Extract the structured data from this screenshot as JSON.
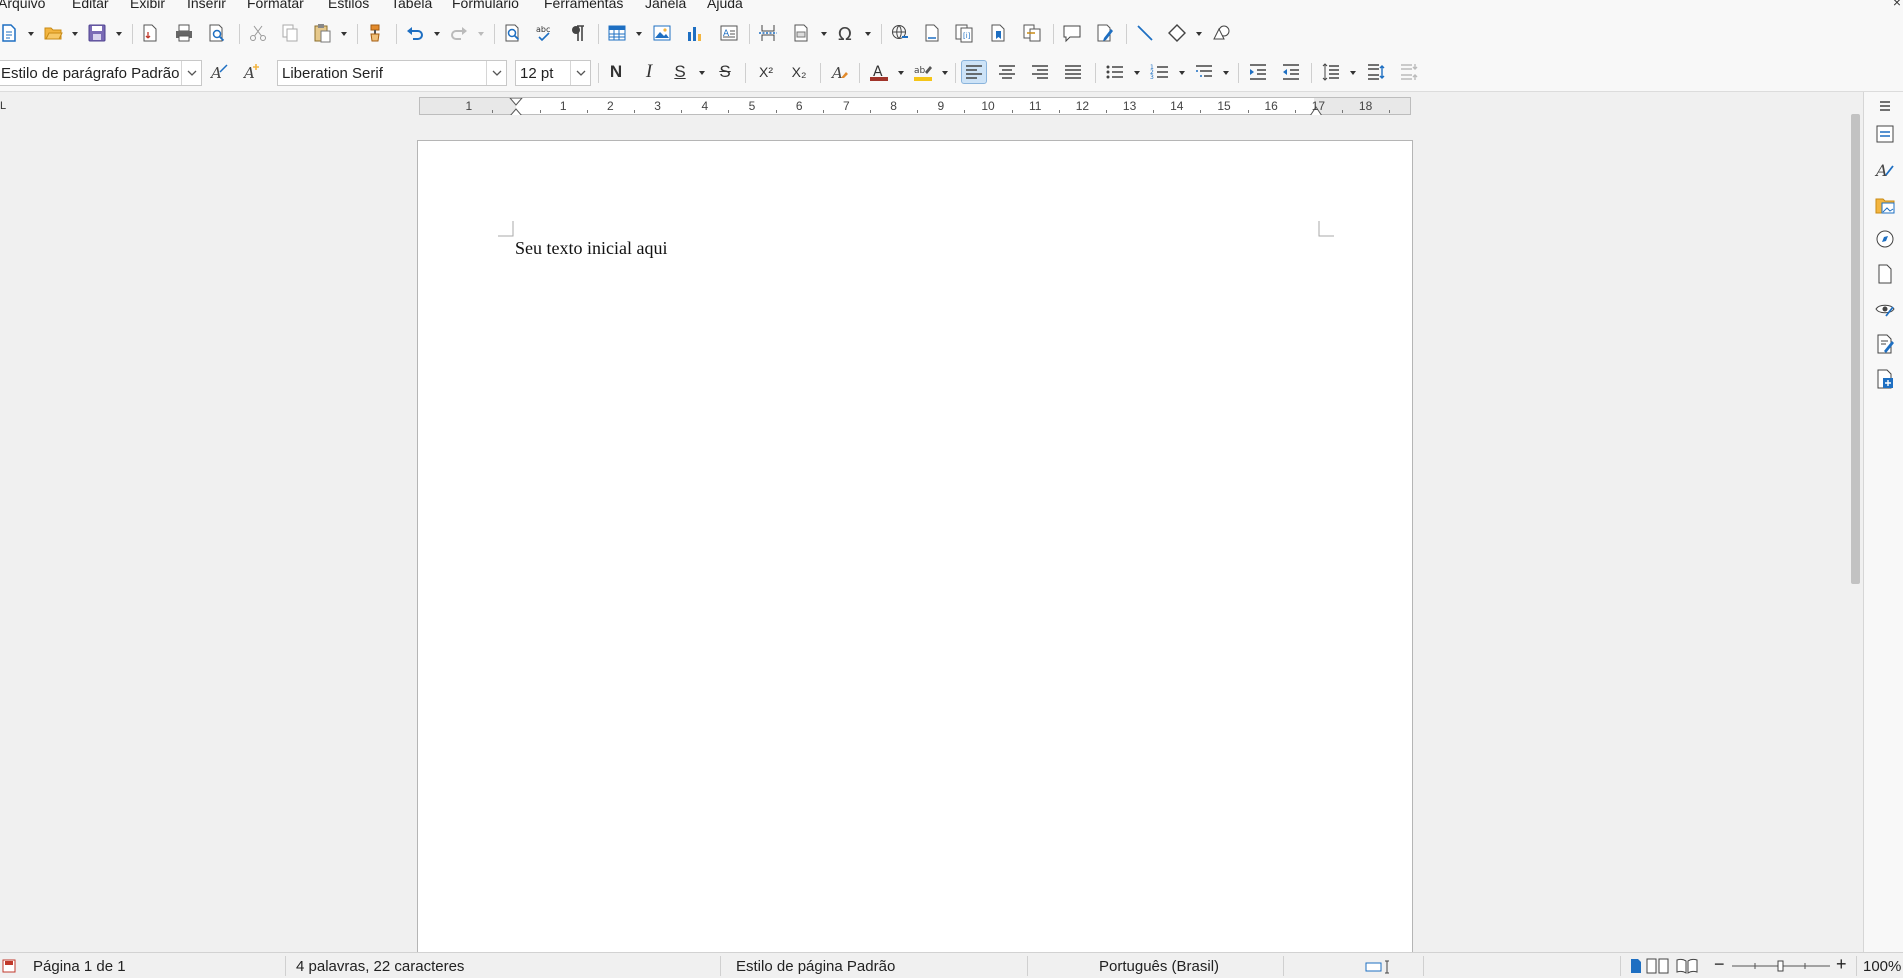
{
  "menu": [
    "Arquivo",
    "Editar",
    "Exibir",
    "Inserir",
    "Formatar",
    "Estilos",
    "Tabela",
    "Formulário",
    "Ferramentas",
    "Janela",
    "Ajuda"
  ],
  "close_glyph": "×",
  "formatting": {
    "paragraph_style": "Estilo de parágrafo Padrão",
    "font_name": "Liberation Serif",
    "font_size": "12 pt",
    "bold_label": "N",
    "italic_label": "I",
    "underline_label": "S",
    "strike_label": "S",
    "superscript_label": "X²",
    "subscript_label": "X₂"
  },
  "ruler": {
    "corner_mark": "L",
    "labels": [
      "1",
      "1",
      "2",
      "3",
      "4",
      "5",
      "6",
      "7",
      "8",
      "9",
      "10",
      "11",
      "12",
      "13",
      "14",
      "15",
      "16",
      "17",
      "18"
    ]
  },
  "document": {
    "text": "Seu texto inicial aqui"
  },
  "status": {
    "page": "Página 1 de 1",
    "words": "4 palavras, 22 caracteres",
    "page_style": "Estilo de página Padrão",
    "language": "Português (Brasil)",
    "zoom": "100%"
  },
  "colors": {
    "accent": "#1e6fc2",
    "font_color": "#c0392b",
    "highlight": "#f5c518"
  }
}
